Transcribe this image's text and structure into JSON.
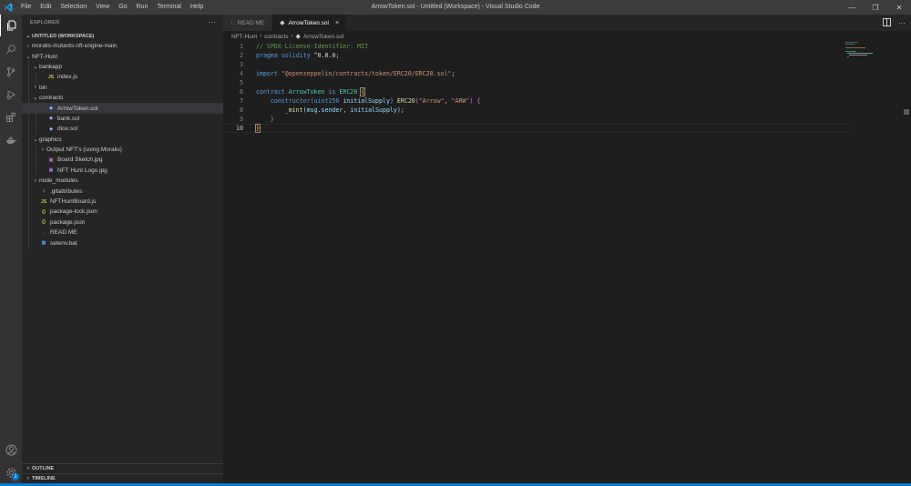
{
  "titlebar": {
    "menu": [
      "File",
      "Edit",
      "Selection",
      "View",
      "Go",
      "Run",
      "Terminal",
      "Help"
    ],
    "title": "ArrowToken.sol - Untitled (Workspace) - Visual Studio Code"
  },
  "activity": {
    "items": [
      "files-icon",
      "search-icon",
      "source-control-icon",
      "run-debug-icon",
      "extensions-icon",
      "docker-icon"
    ],
    "bottom": [
      "account-icon",
      "manage-gear-icon"
    ],
    "badge": "1"
  },
  "explorer": {
    "header": "EXPLORER",
    "more": "···",
    "workspace": "UNTITLED (WORKSPACE)",
    "items": [
      {
        "label": "moralis-mutants-nft-engine-main",
        "indent": 0,
        "chevron": "›",
        "icon": ""
      },
      {
        "label": "NFT-Hunt",
        "indent": 0,
        "chevron": "⌄",
        "icon": ""
      },
      {
        "label": "bankapp",
        "indent": 1,
        "chevron": "⌄",
        "icon": ""
      },
      {
        "label": "index.js",
        "indent": 2,
        "chevron": "",
        "icon": "JS"
      },
      {
        "label": "bin",
        "indent": 1,
        "chevron": "›",
        "icon": ""
      },
      {
        "label": "contracts",
        "indent": 1,
        "chevron": "⌄",
        "icon": ""
      },
      {
        "label": "ArrowToken.sol",
        "indent": 2,
        "chevron": "",
        "icon": "S",
        "selected": true
      },
      {
        "label": "bank.sol",
        "indent": 2,
        "chevron": "",
        "icon": "S"
      },
      {
        "label": "dice.sol",
        "indent": 2,
        "chevron": "",
        "icon": "S"
      },
      {
        "label": "graphics",
        "indent": 1,
        "chevron": "⌄",
        "icon": ""
      },
      {
        "label": "Output NFT's (using Moralis)",
        "indent": 2,
        "chevron": "›",
        "icon": ""
      },
      {
        "label": "Board Sketch.jpg",
        "indent": 2,
        "chevron": "",
        "icon": "IMG"
      },
      {
        "label": "NFT Hunt Logo.jpg",
        "indent": 2,
        "chevron": "",
        "icon": "IMG"
      },
      {
        "label": "node_modules",
        "indent": 1,
        "chevron": "›",
        "icon": ""
      },
      {
        "label": ".gitattributes",
        "indent": 1,
        "chevron": "",
        "icon": "GIT"
      },
      {
        "label": "NFTHuntBoard.js",
        "indent": 1,
        "chevron": "",
        "icon": "JS"
      },
      {
        "label": "package-lock.json",
        "indent": 1,
        "chevron": "",
        "icon": "{}"
      },
      {
        "label": "package.json",
        "indent": 1,
        "chevron": "",
        "icon": "{}"
      },
      {
        "label": "READ ME",
        "indent": 1,
        "chevron": "",
        "icon": "MD"
      },
      {
        "label": "setenv.bat",
        "indent": 1,
        "chevron": "",
        "icon": "BAT"
      }
    ],
    "outline": "OUTLINE",
    "timeline": "TIMELINE"
  },
  "tabs": [
    {
      "label": "READ ME",
      "active": false
    },
    {
      "label": "ArrowToken.sol",
      "active": true,
      "close": "×"
    }
  ],
  "breadcrumb": [
    "NFT-Hunt",
    "contracts",
    "ArrowToken.sol"
  ],
  "editor": {
    "current_line": 10,
    "lines": [
      [
        [
          "c-com",
          "// SPDX-License-Identifier: MIT"
        ]
      ],
      [
        [
          "c-kw",
          "pragma"
        ],
        [
          "c-txt",
          " "
        ],
        [
          "c-kw",
          "solidity"
        ],
        [
          "c-txt",
          " ^0.8.0;"
        ]
      ],
      [],
      [
        [
          "c-kw",
          "import"
        ],
        [
          "c-txt",
          " "
        ],
        [
          "c-str",
          "\"@openzeppelin/contracts/token/ERC20/ERC20.sol\""
        ],
        [
          "c-txt",
          ";"
        ]
      ],
      [],
      [
        [
          "c-kw",
          "contract"
        ],
        [
          "c-txt",
          " "
        ],
        [
          "c-ty",
          "ArrowToken"
        ],
        [
          "c-txt",
          " "
        ],
        [
          "c-kw",
          "is"
        ],
        [
          "c-txt",
          " "
        ],
        [
          "c-ty",
          "ERC20"
        ],
        [
          "c-txt",
          " "
        ],
        [
          "c-br1 brk",
          "{"
        ]
      ],
      [
        [
          "c-txt",
          "    "
        ],
        [
          "c-kw",
          "constructor"
        ],
        [
          "c-br2",
          "("
        ],
        [
          "c-kw",
          "uint256"
        ],
        [
          "c-txt",
          " "
        ],
        [
          "c-var",
          "initialSupply"
        ],
        [
          "c-br2",
          ")"
        ],
        [
          "c-txt",
          " "
        ],
        [
          "c-fn",
          "ERC20"
        ],
        [
          "c-br2",
          "("
        ],
        [
          "c-str",
          "\"Arrow\""
        ],
        [
          "c-txt",
          ", "
        ],
        [
          "c-str",
          "\"ARW\""
        ],
        [
          "c-br2",
          ")"
        ],
        [
          "c-txt",
          " "
        ],
        [
          "c-br2",
          "{"
        ]
      ],
      [
        [
          "c-txt",
          "        "
        ],
        [
          "c-fn",
          "_mint"
        ],
        [
          "c-var",
          "("
        ],
        [
          "c-var",
          "msg"
        ],
        [
          "c-txt",
          "."
        ],
        [
          "c-var",
          "sender"
        ],
        [
          "c-txt",
          ", "
        ],
        [
          "c-var",
          "initialSupply"
        ],
        [
          "c-var",
          ")"
        ],
        [
          "c-txt",
          ";"
        ]
      ],
      [
        [
          "c-txt",
          "    "
        ],
        [
          "c-br2",
          "}"
        ]
      ],
      [
        [
          "c-br1 brk",
          "}"
        ]
      ]
    ]
  },
  "tab_actions": [
    "split-editor-icon",
    "more-actions-icon"
  ]
}
